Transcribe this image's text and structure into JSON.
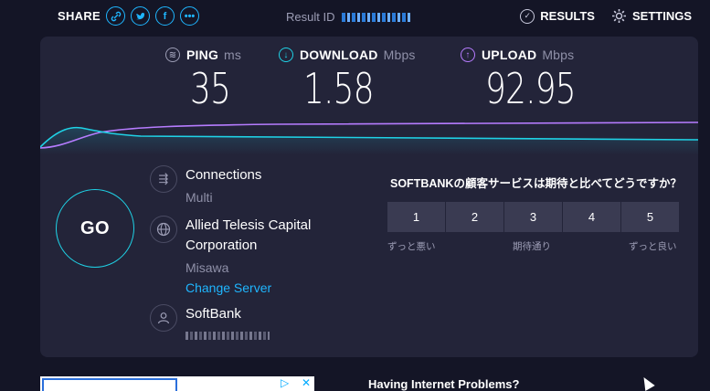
{
  "topbar": {
    "share_label": "SHARE",
    "share_icons": [
      "link-icon",
      "twitter-icon",
      "facebook-icon",
      "more-icon"
    ],
    "result_id_label": "Result ID",
    "results_label": "RESULTS",
    "settings_label": "SETTINGS"
  },
  "metrics": {
    "ping": {
      "label": "PING",
      "unit": "ms",
      "value": "35",
      "color": "#9c9db5"
    },
    "download": {
      "label": "DOWNLOAD",
      "unit": "Mbps",
      "value": "1.58",
      "color": "#1fd2e6"
    },
    "upload": {
      "label": "UPLOAD",
      "unit": "Mbps",
      "value": "92.95",
      "color": "#b67cff"
    }
  },
  "go_label": "GO",
  "connections": {
    "title": "Connections",
    "value": "Multi"
  },
  "server": {
    "name": "Allied Telesis Capital Corporation",
    "location": "Misawa",
    "change_link": "Change Server"
  },
  "isp": {
    "name": "SoftBank"
  },
  "survey": {
    "question": "SOFTBANKの顧客サービスは期待と比べてどうですか？",
    "options": [
      "1",
      "2",
      "3",
      "4",
      "5"
    ],
    "low_label": "ずっと悪い",
    "mid_label": "期待通り",
    "high_label": "ずっと良い"
  },
  "footer": {
    "problems_title": "Having Internet Problems?"
  },
  "colors": {
    "accent": "#1fb6ff",
    "download": "#1fd2e6",
    "upload": "#b67cff",
    "background": "#141526",
    "card": "#232439"
  }
}
